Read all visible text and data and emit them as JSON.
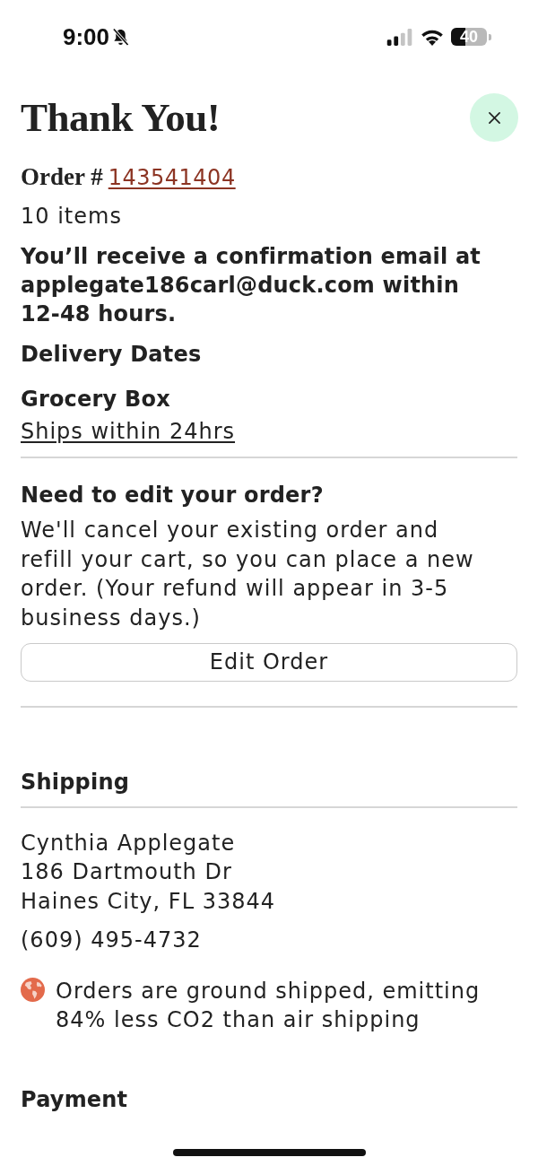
{
  "status_bar": {
    "time": "9:00",
    "battery": "40"
  },
  "header": {
    "title": "Thank You!",
    "order_label": "Order #",
    "order_number": "143541404",
    "item_count": "10 items"
  },
  "confirmation": "You’ll receive a confirmation email at applegate186carl@duck.com within 12-48 hours.",
  "delivery": {
    "heading": "Delivery Dates",
    "items": [
      {
        "name": "Grocery Box",
        "shipping": "Ships within 24hrs"
      }
    ]
  },
  "edit": {
    "heading": "Need to edit your order?",
    "text": "We'll cancel your existing order and refill your cart, so you can place a new order. (Your refund will appear in 3-5 business days.)",
    "button": "Edit Order"
  },
  "shipping": {
    "heading": "Shipping",
    "address_lines": [
      "Cynthia Applegate",
      "186 Dartmouth Dr",
      "Haines City, FL 33844"
    ],
    "phone": "(609) 495-4732",
    "eco_note": "Orders are ground shipped, emitting 84% less CO2 than air shipping"
  },
  "payment": {
    "heading": "Payment"
  }
}
